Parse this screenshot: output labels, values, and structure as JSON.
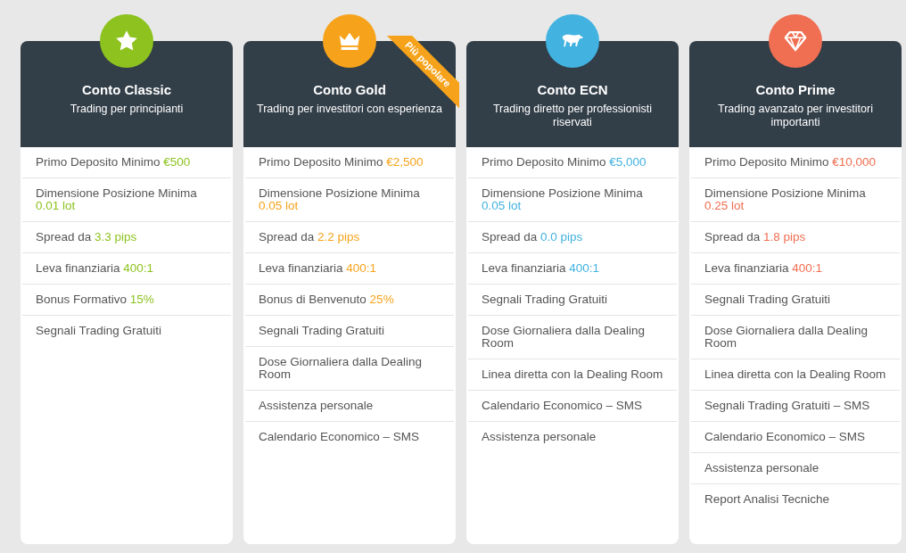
{
  "plans": [
    {
      "title": "Conto Classic",
      "subtitle": "Trading per principianti",
      "color": "#8dc21f",
      "features": [
        {
          "label": "Primo Deposito Minimo",
          "value": "€500"
        },
        {
          "label": "Dimensione Posizione Minima",
          "value": "0.01 lot"
        },
        {
          "label": "Spread da",
          "value": "3.3 pips"
        },
        {
          "label": "Leva finanziaria",
          "value": "400:1"
        },
        {
          "label": "Bonus Formativo",
          "value": "15%"
        },
        {
          "label": "Segnali Trading Gratuiti"
        }
      ]
    },
    {
      "title": "Conto Gold",
      "subtitle": "Trading per investitori con esperienza",
      "color": "#f6a31b",
      "badge": "Più popolare",
      "features": [
        {
          "label": "Primo Deposito Minimo",
          "value": "€2,500"
        },
        {
          "label": "Dimensione Posizione Minima",
          "value": "0.05 lot"
        },
        {
          "label": "Spread da",
          "value": "2.2 pips"
        },
        {
          "label": "Leva finanziaria",
          "value": "400:1"
        },
        {
          "label": "Bonus di Benvenuto",
          "value": "25%"
        },
        {
          "label": "Segnali Trading Gratuiti"
        },
        {
          "label": "Dose Giornaliera dalla Dealing Room"
        },
        {
          "label": "Assistenza personale"
        },
        {
          "label": "Calendario Economico – SMS"
        }
      ]
    },
    {
      "title": "Conto ECN",
      "subtitle": "Trading diretto per professionisti riservati",
      "color": "#42b2e0",
      "features": [
        {
          "label": "Primo Deposito Minimo",
          "value": "€5,000"
        },
        {
          "label": "Dimensione Posizione Minima",
          "value": "0.05 lot"
        },
        {
          "label": "Spread da",
          "value": "0.0 pips"
        },
        {
          "label": "Leva finanziaria",
          "value": "400:1"
        },
        {
          "label": "Segnali Trading Gratuiti"
        },
        {
          "label": "Dose Giornaliera dalla Dealing Room"
        },
        {
          "label": "Linea diretta con la Dealing Room"
        },
        {
          "label": "Calendario Economico – SMS"
        },
        {
          "label": "Assistenza personale"
        }
      ]
    },
    {
      "title": "Conto Prime",
      "subtitle": "Trading avanzato per investitori importanti",
      "color": "#f06e51",
      "features": [
        {
          "label": "Primo Deposito Minimo",
          "value": "€10,000"
        },
        {
          "label": "Dimensione Posizione Minima",
          "value": "0.25 lot"
        },
        {
          "label": "Spread da",
          "value": "1.8 pips"
        },
        {
          "label": "Leva finanziaria",
          "value": "400:1"
        },
        {
          "label": "Segnali Trading Gratuiti"
        },
        {
          "label": "Dose Giornaliera dalla Dealing Room"
        },
        {
          "label": "Linea diretta con la Dealing Room"
        },
        {
          "label": "Segnali Trading Gratuiti – SMS"
        },
        {
          "label": "Calendario Economico – SMS"
        },
        {
          "label": "Assistenza personale"
        },
        {
          "label": "Report Analisi Tecniche"
        }
      ]
    }
  ]
}
